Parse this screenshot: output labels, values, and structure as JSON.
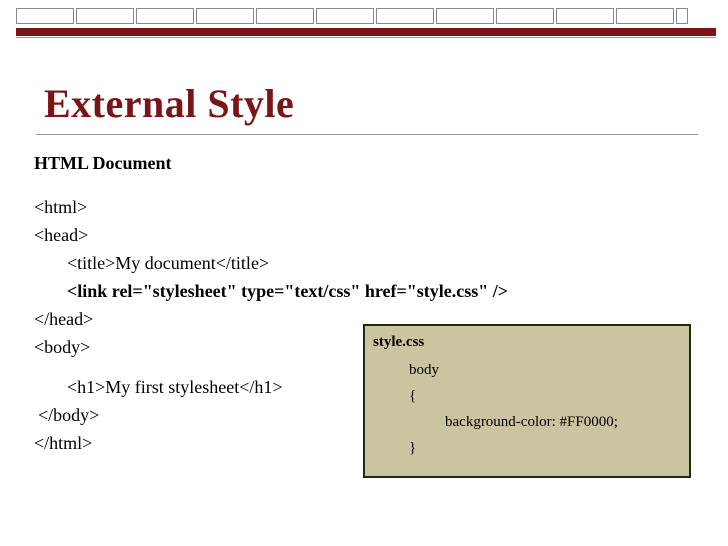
{
  "slide": {
    "title": "External Style",
    "subtitle": "HTML Document"
  },
  "code_lines": [
    "<html>",
    "<head>",
    "<title>My document</title>",
    "<link rel=\"stylesheet\" type=\"text/css\" href=\"style.css\" />",
    "</head>",
    "<body>",
    "<h1>My first stylesheet</h1>",
    "</body>",
    "</html>"
  ],
  "css_box": {
    "title": "style.css",
    "lines": [
      "body",
      "{",
      "background-color: #FF0000;",
      "}"
    ]
  },
  "colors": {
    "accent": "#7a1416",
    "box_fill": "#cac4a0",
    "box_border": "#1e2a12"
  }
}
